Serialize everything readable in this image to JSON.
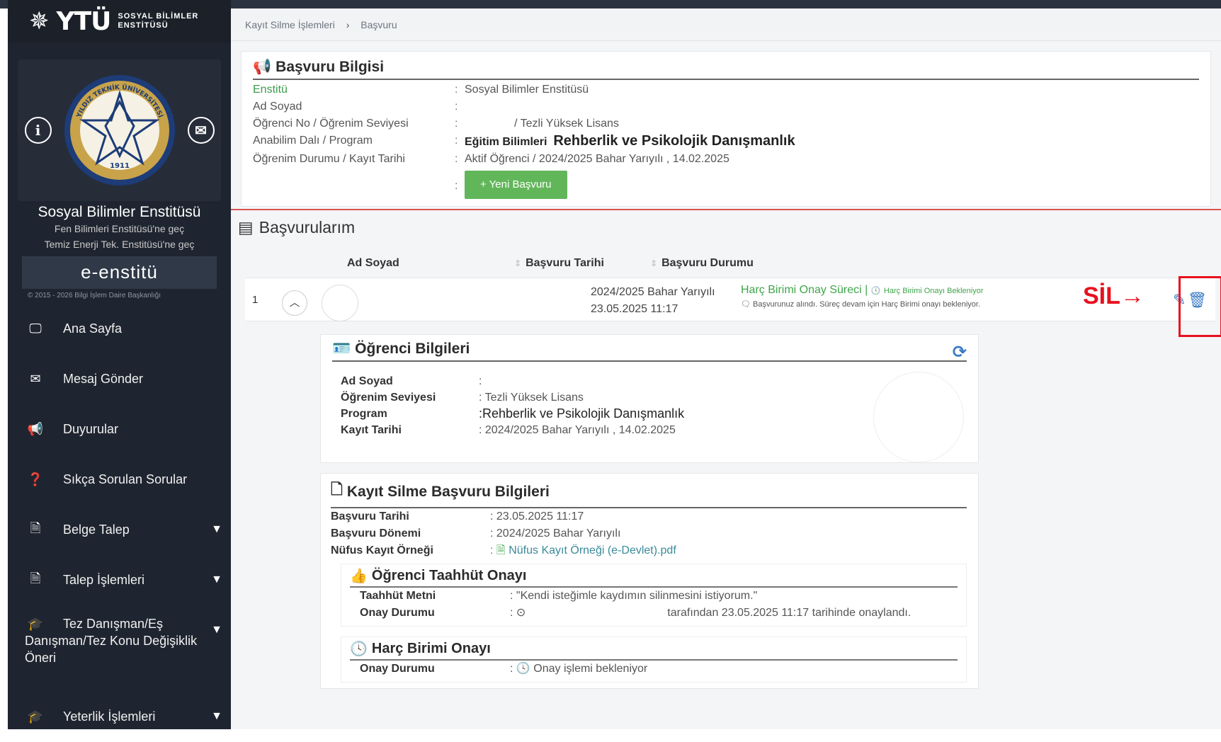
{
  "sidebar": {
    "logo_text": "YTÜ",
    "logo_sub_line1": "SOSYAL BİLİMLER",
    "logo_sub_line2": "ENSTİTÜSÜ",
    "seal_year": "1911",
    "seal_text": "YILDIZ TEKNİK ÜNİVERSİTESİ",
    "institute_name": "Sosyal Bilimler Enstitüsü",
    "switch_links": [
      "Fen Bilimleri Enstitüsü'ne geç",
      "Temiz Enerji Tek. Enstitüsü'ne geç"
    ],
    "system_name": "e-enstitü",
    "copyright": "© 2015 - 2026 Bilgi İşlem Daire Başkanlığı",
    "items": [
      {
        "label": "Ana Sayfa",
        "icon": "monitor-icon"
      },
      {
        "label": "Mesaj Gönder",
        "icon": "envelope-icon"
      },
      {
        "label": "Duyurular",
        "icon": "bullhorn-icon"
      },
      {
        "label": "Sıkça Sorulan Sorular",
        "icon": "question-icon"
      },
      {
        "label": "Belge Talep",
        "icon": "file-icon"
      },
      {
        "label": "Talep İşlemleri",
        "icon": "file-icon"
      },
      {
        "label": "Tez Danışman/Eş Danışman/Tez Konu Değişiklik Öneri",
        "icon": "graduation-cap-icon"
      },
      {
        "label": "Yeterlik İşlemleri",
        "icon": "graduation-cap-icon"
      }
    ]
  },
  "breadcrumb": {
    "item1": "Kayıt Silme İşlemleri",
    "item2": "Başvuru"
  },
  "info": {
    "title": "Başvuru Bilgisi",
    "labels": [
      "Enstitü",
      "Ad Soyad",
      "Öğrenci No / Öğrenim Seviyesi",
      "Anabilim Dalı / Program",
      "Öğrenim Durumu / Kayıt Tarihi"
    ],
    "institute": "Sosyal Bilimler Enstitüsü",
    "student_level": "/ Tezli Yüksek Lisans",
    "department": "Eğitim Bilimleri",
    "program": "Rehberlik ve Psikolojik Danışmanlık",
    "status_date": "Aktif Öğrenci / 2024/2025 Bahar Yarıyılı , 14.02.2025",
    "new_button": "+ Yeni Başvuru"
  },
  "list": {
    "title": "Başvurularım",
    "col_name": "Ad Soyad",
    "col_date": "Başvuru Tarihi",
    "col_status": "Başvuru Durumu",
    "row_num": "1",
    "row_term": "2024/2025 Bahar Yarıyılı",
    "row_date": "23.05.2025 11:17",
    "row_status": "Harç Birimi Onay Süreci |",
    "row_status_small": "Harç Birimi Onayı Bekleniyor",
    "row_desc": "Başvurunuz alındı. Süreç devam için Harç Birimi onayı bekleniyor.",
    "annotation": "SİL→"
  },
  "student": {
    "title": "Öğrenci Bilgileri",
    "k_name": "Ad Soyad",
    "k_level": "Öğrenim Seviyesi",
    "k_program": "Program",
    "k_reg": "Kayıt Tarihi",
    "v_name": ":",
    "v_level": ": Tezli Yüksek Lisans",
    "v_program": ":Rehberlik ve Psikolojik Danışmanlık",
    "v_reg": ": 2024/2025 Bahar Yarıyılı , 14.02.2025"
  },
  "application": {
    "title": "Kayıt Silme Başvuru Bilgileri",
    "k_date": "Başvuru Tarihi",
    "k_term": "Başvuru Dönemi",
    "k_doc": "Nüfus Kayıt Örneği",
    "v_date": ": 23.05.2025 11:17",
    "v_term": ": 2024/2025 Bahar Yarıyılı",
    "v_doc": "Nüfus Kayıt Örneği (e-Devlet).pdf"
  },
  "pledge": {
    "title": "Öğrenci Taahhüt Onayı",
    "k_text": "Taahhüt Metni",
    "k_status": "Onay Durumu",
    "v_text": ": \"Kendi isteğimle kaydımın silinmesini istiyorum.\"",
    "v_status": "tarafından 23.05.2025 11:17 tarihinde onaylandı."
  },
  "fee": {
    "title": "Harç Birimi Onayı",
    "k_status": "Onay Durumu",
    "v_status": "Onay işlemi bekleniyor"
  }
}
